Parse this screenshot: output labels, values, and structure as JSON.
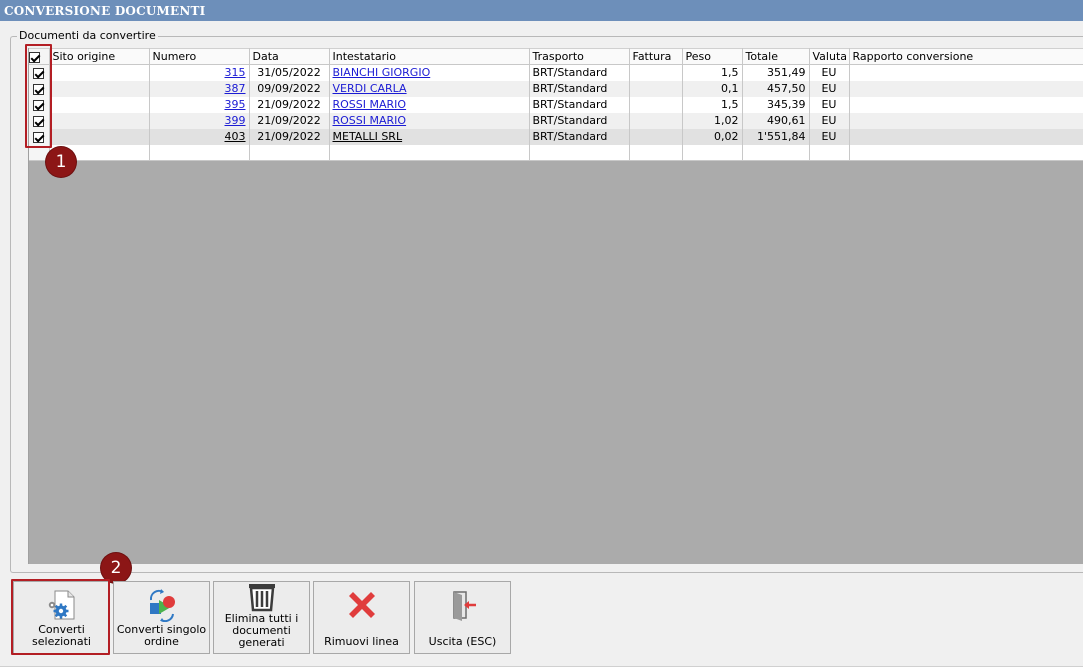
{
  "window": {
    "title": "CONVERSIONE DOCUMENTI"
  },
  "group": {
    "label": "Documenti da convertire"
  },
  "table": {
    "columns": [
      "Sito origine",
      "Numero",
      "Data",
      "Intestatario",
      "Trasporto",
      "Fattura",
      "Peso",
      "Totale",
      "Valuta",
      "Rapporto conversione"
    ],
    "rows": [
      {
        "numero": "315",
        "data": "31/05/2022",
        "intestatario": "BIANCHI GIORGIO",
        "trasporto": "BRT/Standard",
        "fattura": "",
        "peso": "1,5",
        "totale": "351,49",
        "valuta": "EU",
        "rapporto": ""
      },
      {
        "numero": "387",
        "data": "09/09/2022",
        "intestatario": "VERDI CARLA",
        "trasporto": "BRT/Standard",
        "fattura": "",
        "peso": "0,1",
        "totale": "457,50",
        "valuta": "EU",
        "rapporto": ""
      },
      {
        "numero": "395",
        "data": "21/09/2022",
        "intestatario": "ROSSI MARIO",
        "trasporto": "BRT/Standard",
        "fattura": "",
        "peso": "1,5",
        "totale": "345,39",
        "valuta": "EU",
        "rapporto": ""
      },
      {
        "numero": "399",
        "data": "21/09/2022",
        "intestatario": "ROSSI MARIO",
        "trasporto": "BRT/Standard",
        "fattura": "",
        "peso": "1,02",
        "totale": "490,61",
        "valuta": "EU",
        "rapporto": ""
      },
      {
        "numero": "403",
        "data": "21/09/2022",
        "intestatario": "METALLI SRL",
        "trasporto": "BRT/Standard",
        "fattura": "",
        "peso": "0,02",
        "totale": "1'551,84",
        "valuta": "EU",
        "rapporto": ""
      }
    ]
  },
  "annotations": {
    "badge1": "1",
    "badge2": "2"
  },
  "buttons": {
    "converti_selezionati": "Converti selezionati",
    "converti_singolo": "Converti singolo ordine",
    "elimina_tutti": "Elimina tutti i documenti generati",
    "rimuovi_linea": "Rimuovi linea",
    "uscita": "Uscita (ESC)"
  },
  "colors": {
    "title_bar": "#6d8fba",
    "highlight": "#b31e24",
    "badge": "#8c1616",
    "link": "#1b1bd4"
  }
}
